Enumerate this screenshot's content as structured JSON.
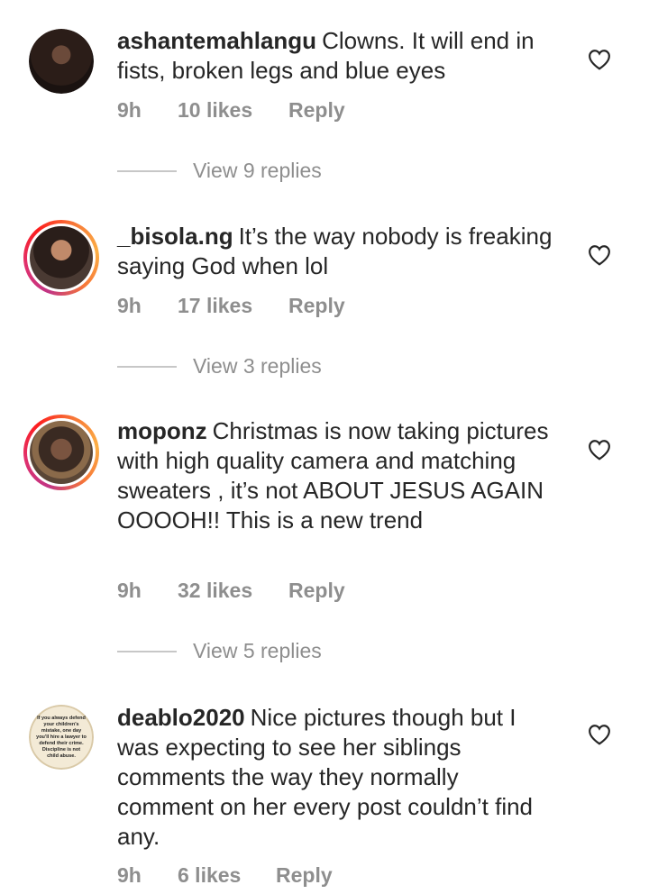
{
  "comments": [
    {
      "username": "ashantemahlangu",
      "text": "Clowns. It will end in fists, broken legs and blue eyes",
      "time": "9h",
      "likes": "10 likes",
      "reply": "Reply",
      "view_replies": "View 9 replies"
    },
    {
      "username": "_bisola.ng",
      "text": "It’s the way nobody is freaking saying God when lol",
      "time": "9h",
      "likes": "17 likes",
      "reply": "Reply",
      "view_replies": "View 3 replies"
    },
    {
      "username": "moponz",
      "text": "Christmas is now taking pictures with high quality camera and matching sweaters , it’s not ABOUT JESUS AGAIN OOOOH!! This is a new trend",
      "time": "9h",
      "likes": "32 likes",
      "reply": "Reply",
      "view_replies": "View 5 replies"
    },
    {
      "username": "deablo2020",
      "text": "Nice pictures though but I was expecting to see her siblings comments the way they normally comment on her every post couldn’t find any.",
      "time": "9h",
      "likes": "6 likes",
      "reply": "Reply",
      "avatar_text": "If you always defend your children's mistake, one day you'll hire a lawyer to defend their crime. Discipline is not child abuse."
    }
  ],
  "colors": {
    "text": "#262626",
    "secondary": "#8e8e8e",
    "divider": "#c7c7c7"
  }
}
